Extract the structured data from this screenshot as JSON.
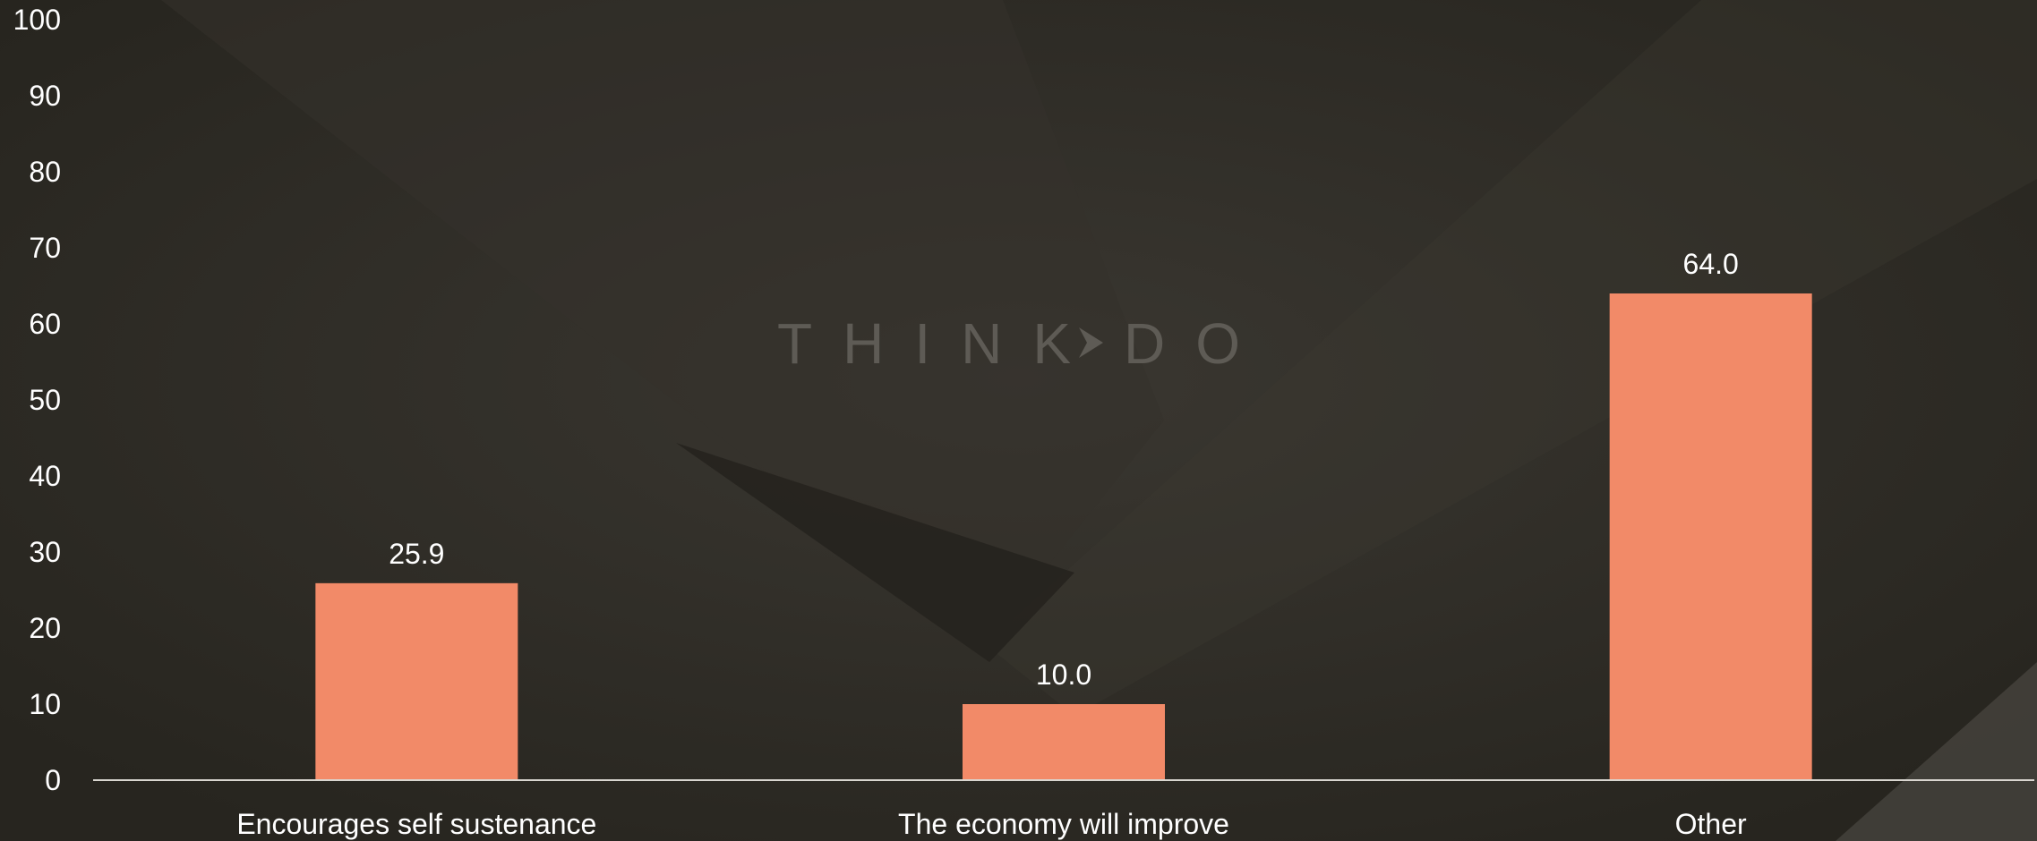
{
  "watermark": {
    "left_text": "THINK",
    "right_text": "DO"
  },
  "colors": {
    "background": "#2b2925",
    "bar": "#f28a68",
    "axis": "#d9d6d0",
    "text": "#ffffff"
  },
  "chart_data": {
    "type": "bar",
    "categories": [
      "Encourages self sustenance",
      "The economy will improve",
      "Other"
    ],
    "values": [
      25.9,
      10.0,
      64.0
    ],
    "data_labels": [
      "25.9",
      "10.0",
      "64.0"
    ],
    "ylim": [
      0,
      100
    ],
    "yticks": [
      0,
      10,
      20,
      30,
      40,
      50,
      60,
      70,
      80,
      90,
      100
    ],
    "ytick_labels": [
      "0",
      "10",
      "20",
      "30",
      "40",
      "50",
      "60",
      "70",
      "80",
      "90",
      "100"
    ],
    "grid": false,
    "legend": "none",
    "title": "",
    "xlabel": "",
    "ylabel": ""
  }
}
